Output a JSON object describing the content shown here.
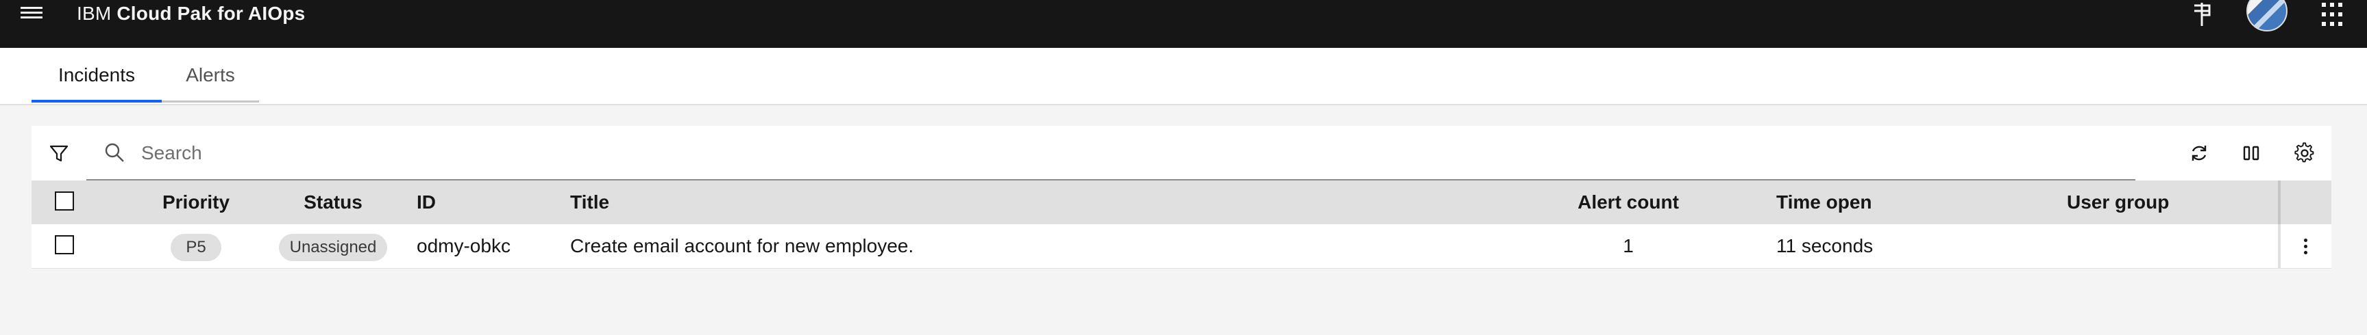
{
  "header": {
    "brand_prefix": "IBM",
    "brand_name": "Cloud Pak for AIOps",
    "icons": [
      "menu-icon",
      "pin-icon",
      "avatar",
      "app-switcher-icon"
    ]
  },
  "tabs": [
    {
      "label": "Incidents",
      "selected": true
    },
    {
      "label": "Alerts",
      "selected": false
    }
  ],
  "toolbar": {
    "search_placeholder": "Search",
    "search_value": "",
    "icons": [
      "filter-icon",
      "search-icon",
      "refresh-icon",
      "columns-icon",
      "settings-icon"
    ]
  },
  "table": {
    "columns": [
      "Priority",
      "Status",
      "ID",
      "Title",
      "Alert count",
      "Time open",
      "User group"
    ],
    "rows": [
      {
        "priority": "P5",
        "status": "Unassigned",
        "id": "odmy-obkc",
        "title": "Create email account for new employee.",
        "alert_count": "1",
        "time_open": "11 seconds",
        "user_group": ""
      }
    ]
  },
  "colors": {
    "header_bg": "#161616",
    "accent": "#0f62fe",
    "page_bg": "#f4f4f4",
    "table_header_bg": "#e0e0e0"
  }
}
